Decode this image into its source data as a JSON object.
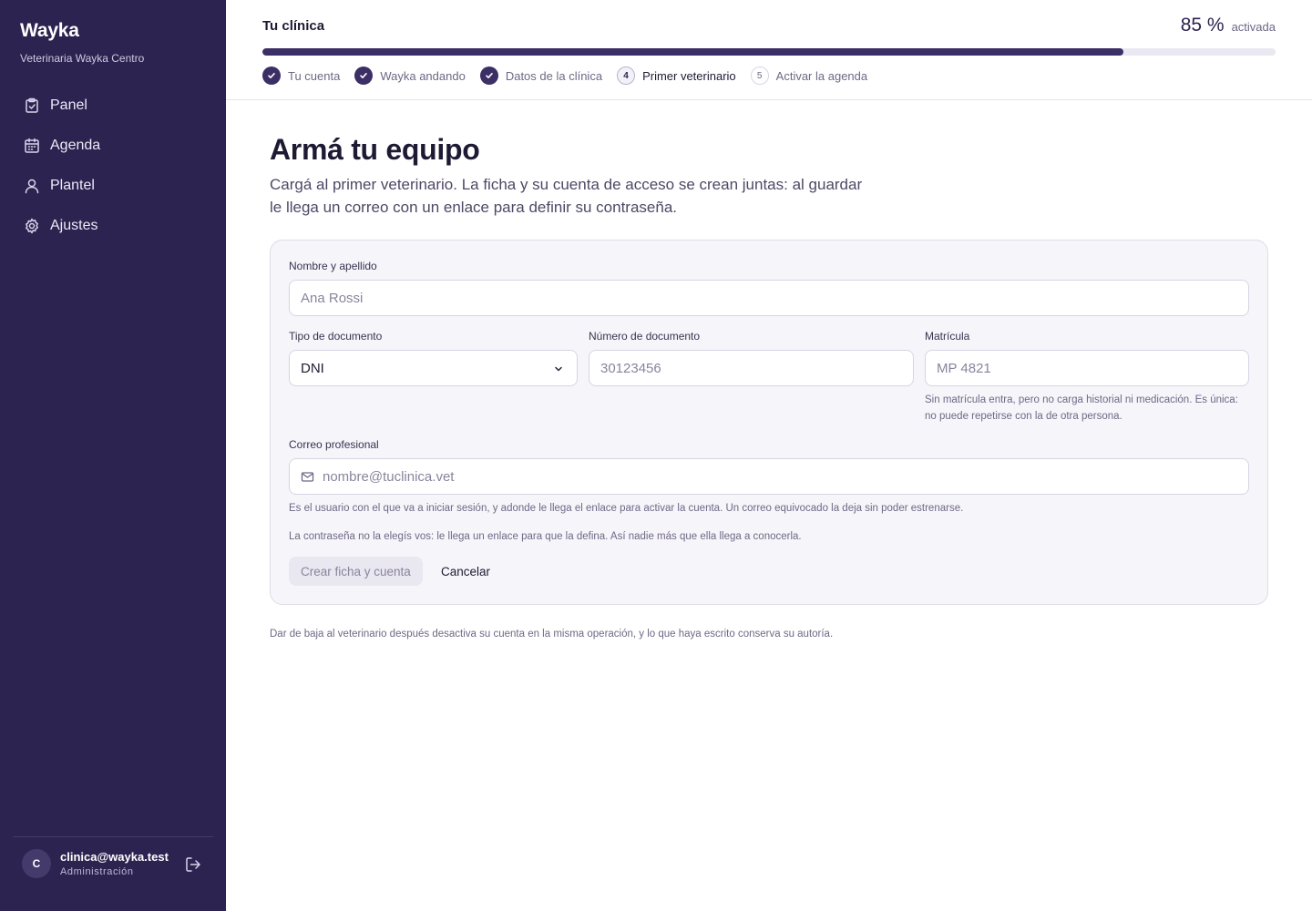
{
  "sidebar": {
    "brand": "Wayka",
    "clinic": "Veterinaria Wayka Centro",
    "items": [
      {
        "label": "Panel",
        "icon": "clipboard-check-icon"
      },
      {
        "label": "Agenda",
        "icon": "calendar-icon"
      },
      {
        "label": "Plantel",
        "icon": "user-icon"
      },
      {
        "label": "Ajustes",
        "icon": "gear-icon"
      }
    ],
    "user": {
      "initial": "C",
      "email": "clinica@wayka.test",
      "role": "Administración"
    }
  },
  "header": {
    "title": "Tu clínica",
    "percent": "85 %",
    "percent_label": "activada",
    "progress": 0.85,
    "steps": [
      {
        "label": "Tu cuenta",
        "state": "done"
      },
      {
        "label": "Wayka andando",
        "state": "done"
      },
      {
        "label": "Datos de la clínica",
        "state": "done"
      },
      {
        "number": "4",
        "label": "Primer veterinario",
        "state": "current"
      },
      {
        "number": "5",
        "label": "Activar la agenda",
        "state": "todo"
      }
    ]
  },
  "main": {
    "title": "Armá tu equipo",
    "description": "Cargá al primer veterinario. La ficha y su cuenta de acceso se crean juntas: al guardar le llega un correo con un enlace para definir su contraseña.",
    "form": {
      "name_label": "Nombre y apellido",
      "name_placeholder": "Ana Rossi",
      "doc_type_label": "Tipo de documento",
      "doc_type_value": "DNI",
      "doc_number_label": "Número de documento",
      "doc_number_placeholder": "30123456",
      "license_label": "Matrícula",
      "license_placeholder": "MP 4821",
      "license_help": "Sin matrícula entra, pero no carga historial ni medicación. Es única: no puede repetirse con la de otra persona.",
      "email_label": "Correo profesional",
      "email_placeholder": "nombre@tuclinica.vet",
      "email_help": "Es el usuario con el que va a iniciar sesión, y adonde le llega el enlace para activar la cuenta. Un correo equivocado la deja sin poder estrenarse.",
      "password_help": "La contraseña no la elegís vos: le llega un enlace para que la defina. Así nadie más que ella llega a conocerla.",
      "submit_label": "Crear ficha y cuenta",
      "cancel_label": "Cancelar"
    },
    "footnote": "Dar de baja al veterinario después desactiva su cuenta en la misma operación, y lo que haya escrito conserva su autoría."
  },
  "colors": {
    "sidebar_bg": "#2d2350",
    "accent": "#3b2f66",
    "card_bg": "#f6f5fa"
  }
}
